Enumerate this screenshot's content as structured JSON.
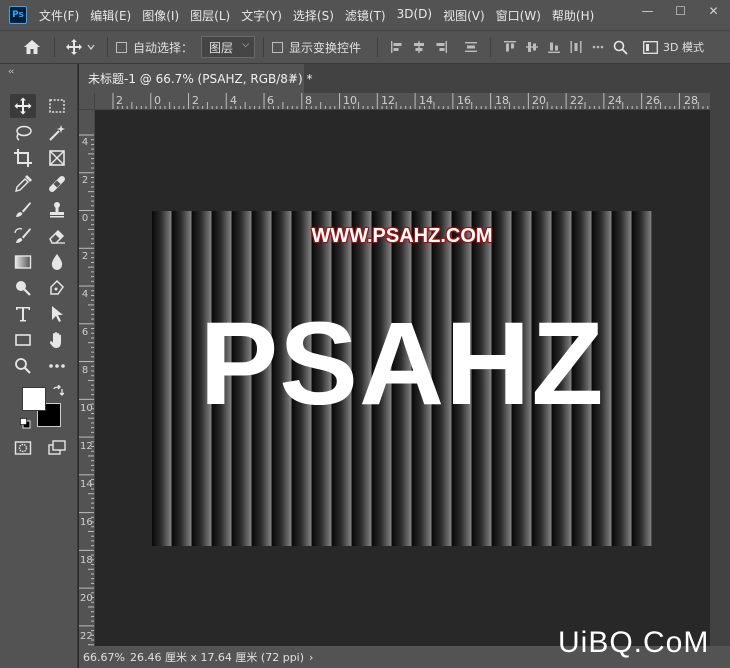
{
  "app": {
    "logo": "Ps"
  },
  "menu": [
    "文件(F)",
    "编辑(E)",
    "图像(I)",
    "图层(L)",
    "文字(Y)",
    "选择(S)",
    "滤镜(T)",
    "3D(D)",
    "视图(V)",
    "窗口(W)",
    "帮助(H)"
  ],
  "window": {
    "minimize": "—",
    "maximize": "☐",
    "close": "✕"
  },
  "options": {
    "auto_select_label": "自动选择：",
    "layer_select_value": "图层",
    "show_transform_label": "显示变换控件",
    "mode_3d_label": "3D 模式"
  },
  "document": {
    "tab_title": "未标题-1 @ 66.7% (PSAHZ, RGB/8#) *",
    "close": "×"
  },
  "ruler": {
    "top_labels": [
      "2",
      "0",
      "2",
      "4",
      "6",
      "8",
      "10",
      "12",
      "14",
      "16",
      "18",
      "20",
      "22",
      "24",
      "26",
      "28"
    ],
    "left_labels": [
      "4",
      "2",
      "0",
      "2",
      "4",
      "6",
      "8",
      "10",
      "12",
      "14",
      "16",
      "18",
      "20",
      "22"
    ]
  },
  "canvas": {
    "url_text": "WWW.PSAHZ.COM",
    "main_text": "PSAHZ"
  },
  "status": {
    "zoom": "66.67%",
    "doc_size": "26.46 厘米 x 17.64 厘米 (72 ppi)",
    "arrow": "›"
  },
  "watermark": "UiBQ.CoM"
}
